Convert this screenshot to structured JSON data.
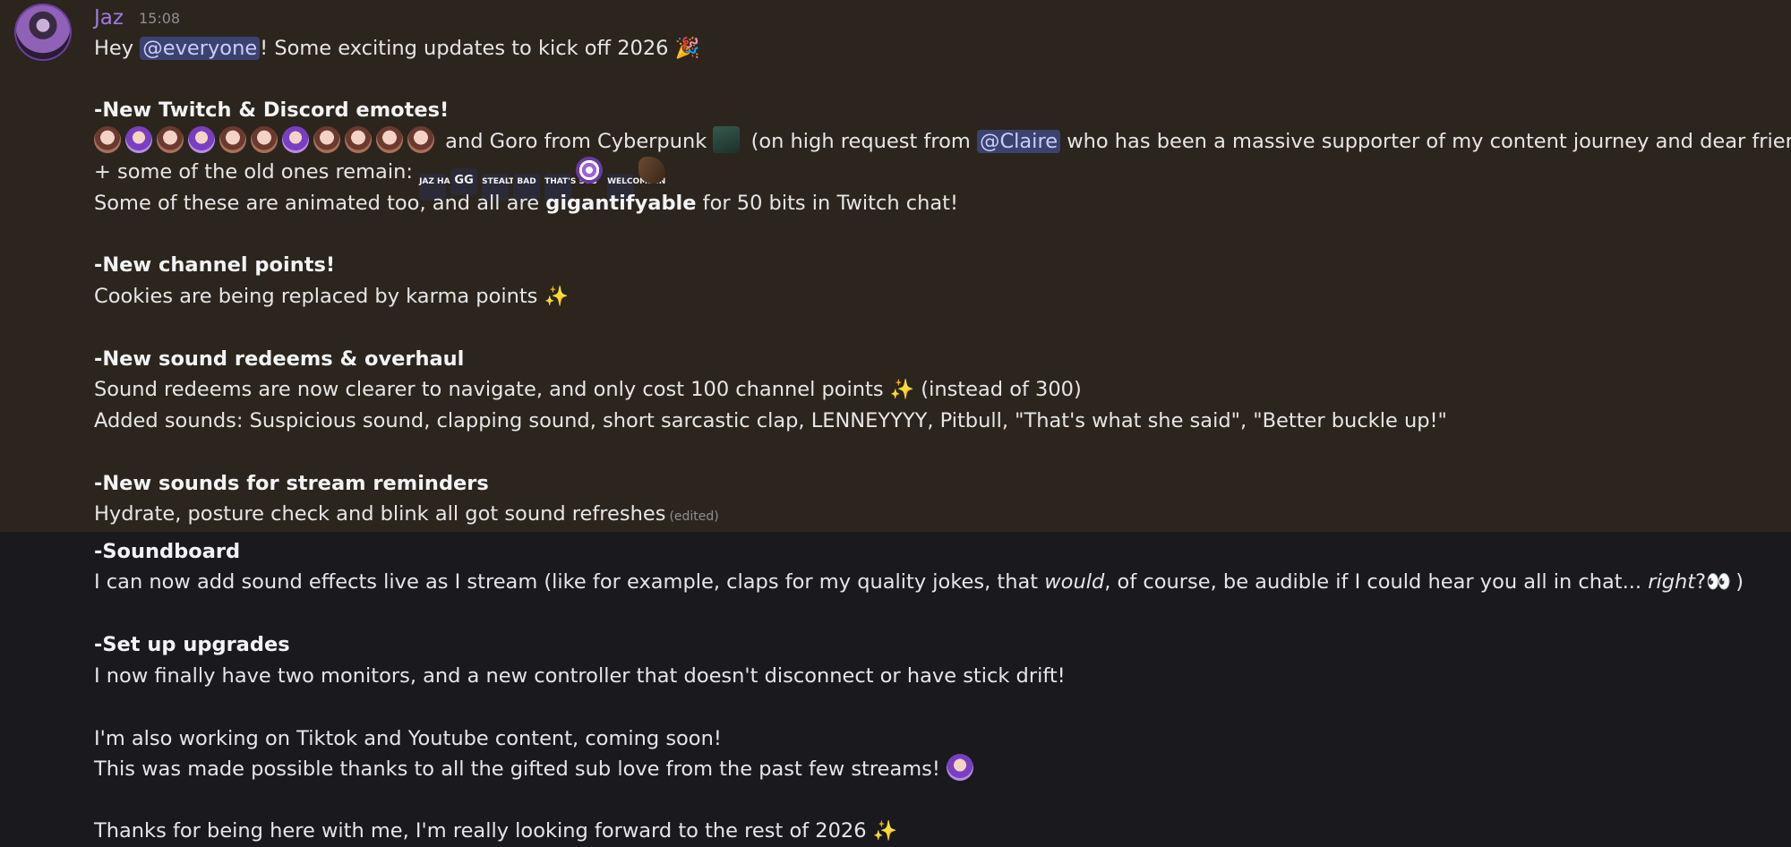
{
  "message": {
    "author": "Jaz",
    "time": "15:08",
    "edited_label": "(edited)"
  },
  "lines": {
    "l1_a": "Hey ",
    "l1_mention": "@everyone",
    "l1_b": "! Some exciting updates to kick off 2026",
    "h1": "-New Twitch & Discord emotes!",
    "l2_a": " and Goro from Cyberpunk",
    "l2_b": " (on high request from ",
    "l2_mention": "@Claire",
    "l2_c": " who has been a massive supporter of my content journey and dear friend)",
    "l3": "+ some of the old ones remain: ",
    "l4_a": "Some of these are animated too, and all are ",
    "l4_bold": "gigantifyable",
    "l4_b": " for 50 bits in Twitch chat!",
    "h2": "-New channel points!",
    "l5": "Cookies are being replaced by karma points",
    "h3": "-New sound redeems & overhaul",
    "l6_a": "Sound redeems are now clearer to navigate, and only cost 100 channel points",
    "l6_b": " (instead of 300)",
    "l7": "Added sounds: Suspicious sound, clapping sound, short sarcastic clap, LENNEYYYY, Pitbull, \"That's what she said\", \"Better buckle up!\"",
    "h4": "-New sounds for stream reminders",
    "l8": "Hydrate, posture check and blink all got sound refreshes",
    "h5": "-Soundboard",
    "l9_a": "I can now add sound effects live as I stream (like for example, claps for my quality jokes, that ",
    "l9_i1": "would",
    "l9_b": ", of course, be audible if I could hear you all in chat... ",
    "l9_i2": "right",
    "l9_c": "?",
    "l9_d": " )",
    "h6": "-Set up upgrades",
    "l10": "I now finally have two monitors, and a new controller that doesn't disconnect or have stick drift!",
    "l11": "I'm also working on Tiktok and Youtube content, coming soon!",
    "l12": "This was made possible thanks to all the gifted sub love from the past few streams!",
    "l13": "Thanks for being here with me, I'm really looking forward to the rest of 2026"
  },
  "old_emote_labels": [
    "JAZ HANDS",
    "GG",
    "STEALTH",
    "BAD",
    "THAT'S SUS",
    "WELCOME IN"
  ],
  "icons": [
    "party-popper-icon",
    "sparkles-icon",
    "eyes-icon",
    "emote-icon"
  ],
  "colors": {
    "highlight_bg": "#2c251d",
    "page_bg": "#1a1a1e",
    "mention_bg": "#3c4270",
    "author": "#a07ad9"
  }
}
